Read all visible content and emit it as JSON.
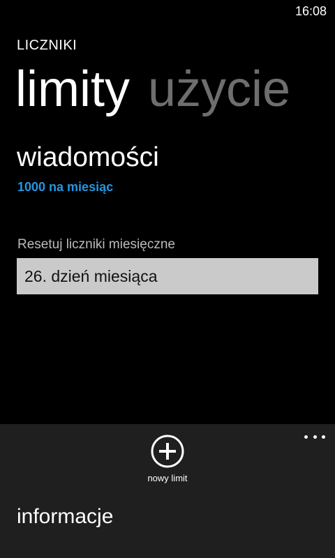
{
  "status_bar": {
    "time": "16:08"
  },
  "app": {
    "title": "LICZNIKI"
  },
  "pivot": {
    "items": [
      {
        "label": "limity",
        "active": true
      },
      {
        "label": "użycie",
        "active": false
      }
    ]
  },
  "limit": {
    "title": "wiadomości",
    "subtitle": "1000 na miesiąc"
  },
  "reset": {
    "label": "Resetuj liczniki miesięczne",
    "value": "26. dzień miesiąca"
  },
  "app_bar": {
    "add_button_label": "nowy limit",
    "add_icon": "plus-circle-icon",
    "more_icon": "ellipsis-icon",
    "menu_items": [
      "informacje"
    ]
  },
  "colors": {
    "background": "#000000",
    "accent": "#2596e0",
    "app_bar": "#1f1f1f",
    "picker": "#cacaca",
    "inactive_pivot": "#6e6e6e"
  }
}
